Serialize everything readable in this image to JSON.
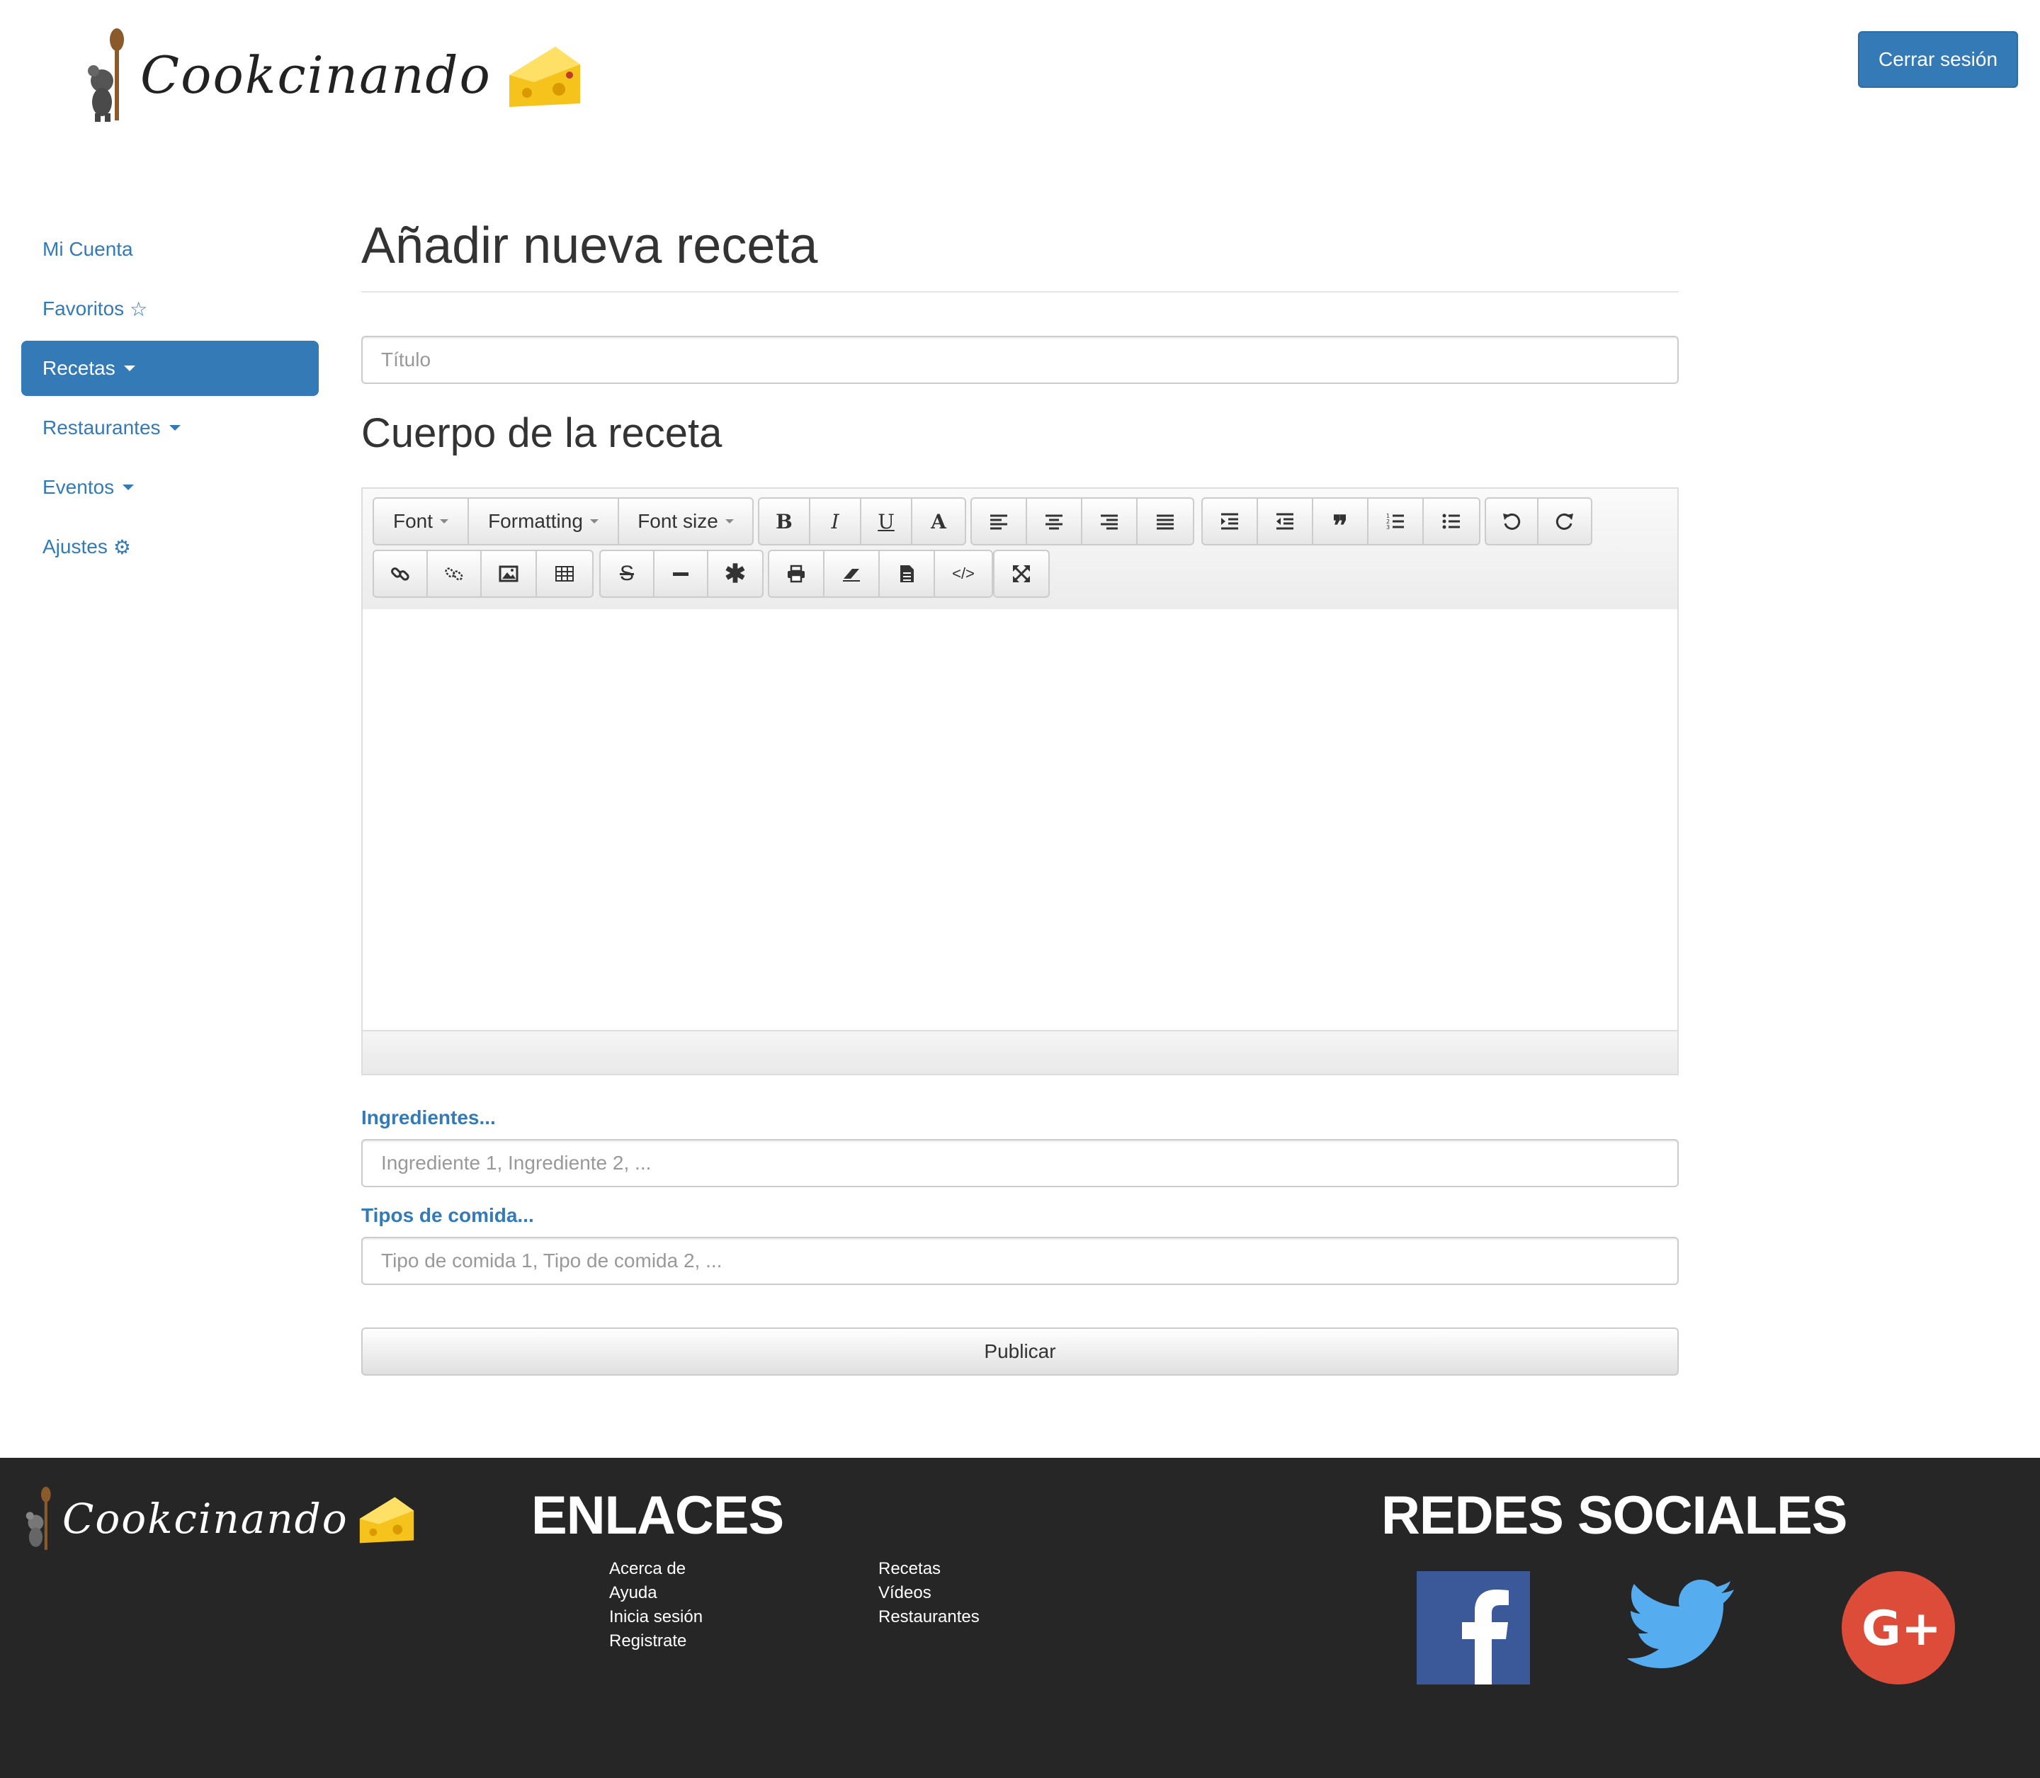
{
  "header": {
    "brand": "Cookcinando",
    "logout_label": "Cerrar sesión"
  },
  "sidebar": {
    "items": [
      {
        "label": "Mi Cuenta"
      },
      {
        "label": "Favoritos"
      },
      {
        "label": "Recetas"
      },
      {
        "label": "Restaurantes"
      },
      {
        "label": "Eventos"
      },
      {
        "label": "Ajustes"
      }
    ]
  },
  "main": {
    "title": "Añadir nueva receta",
    "title_placeholder": "Título",
    "body_heading": "Cuerpo de la receta",
    "toolbar": {
      "font": "Font",
      "formatting": "Formatting",
      "font_size": "Font size",
      "bold": "B",
      "italic": "I",
      "underline": "U",
      "font_color": "A"
    },
    "ingredients_label": "Ingredientes...",
    "ingredients_placeholder": "Ingrediente 1, Ingrediente 2, ...",
    "types_label": "Tipos de comida...",
    "types_placeholder": "Tipo de comida 1, Tipo de comida 2, ...",
    "publish_label": "Publicar"
  },
  "footer": {
    "brand": "Cookcinando",
    "links_heading": "ENLACES",
    "links_col1": [
      "Acerca de",
      "Ayuda",
      "Inicia sesión",
      "Registrate"
    ],
    "links_col2": [
      "Recetas",
      "Vídeos",
      "Restaurantes"
    ],
    "social_heading": "REDES SOCIALES"
  },
  "colors": {
    "primary": "#337ab7",
    "footer_bg": "#262626",
    "facebook": "#3b5998",
    "twitter": "#55acee",
    "google": "#dd4b39"
  }
}
